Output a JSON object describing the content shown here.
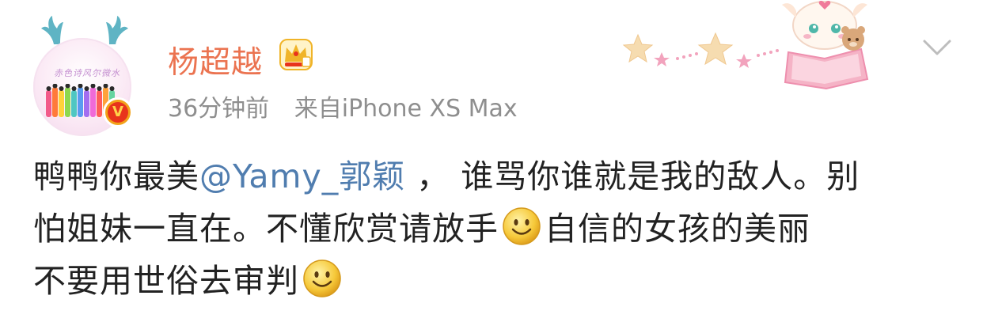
{
  "user": {
    "name": "杨超越",
    "avatar_caption": "赤色诗风尔微水"
  },
  "meta": {
    "time": "36分钟前",
    "source": "来自iPhone XS Max"
  },
  "post": {
    "line1_a": "鸭鸭你最美",
    "line1_mention": "@Yamy_郭颖",
    "line1_b": " ， 谁骂你谁就是我的敌人。别",
    "line2_a": "怕姐妹一直在。不懂欣赏请放手",
    "line2_b": "自信的女孩的美丽",
    "line3_a": "不要用世俗去审判"
  },
  "icons": {
    "verified": "verified-v-icon",
    "crown": "crown-icon",
    "emoji": "smile-emoji-icon",
    "chevron": "chevron-down-icon"
  },
  "colors": {
    "username": "#eb7350",
    "mention": "#507daf",
    "meta": "#8e8e8e",
    "verified": "#e8331c"
  }
}
